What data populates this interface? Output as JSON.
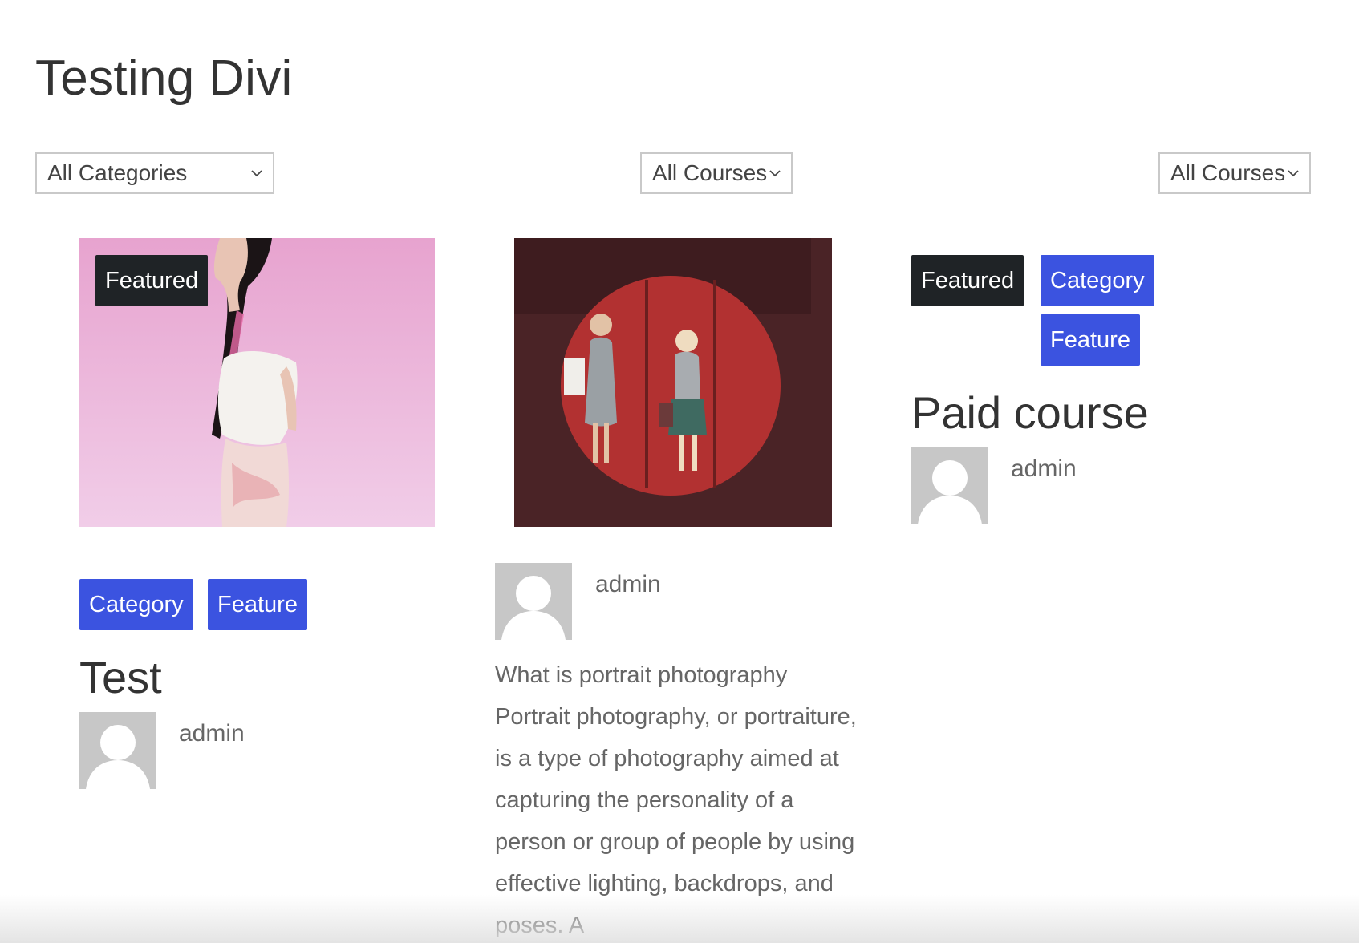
{
  "page": {
    "title": "Testing Divi"
  },
  "filters": {
    "categories": {
      "selected": "All Categories"
    },
    "courses_1": {
      "selected": "All Courses"
    },
    "courses_2": {
      "selected": "All Courses"
    }
  },
  "cards": [
    {
      "featured_label": "Featured",
      "badges": [
        "Category",
        "Feature"
      ],
      "title": "Test",
      "author": "admin"
    },
    {
      "author": "admin",
      "excerpt": "What is portrait photography Portrait photography, or portraiture, is a type of photography aimed at capturing the personality of a person or group of people by using effective lighting, backdrops, and poses. A"
    },
    {
      "featured_label": "Featured",
      "badges": [
        "Category",
        "Feature"
      ],
      "title": "Paid course",
      "author": "admin"
    }
  ],
  "colors": {
    "badge_dark": "#1f2326",
    "badge_blue": "#3b53e0",
    "avatar_bg": "#c7c7c7"
  },
  "icons": {
    "select_arrow": "chevron-down-icon",
    "avatar": "default-user-icon"
  }
}
